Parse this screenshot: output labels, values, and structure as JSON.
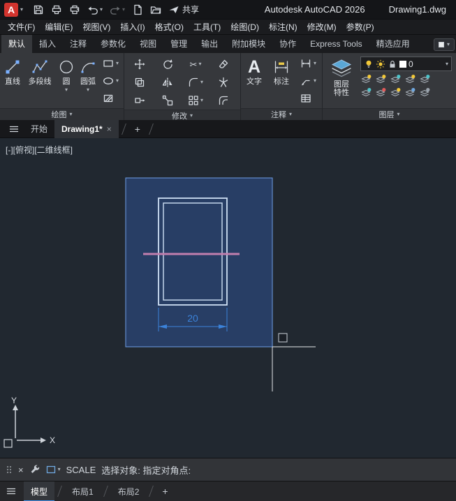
{
  "titlebar": {
    "logo_letter": "A",
    "app_title": "Autodesk AutoCAD 2026",
    "doc_title": "Drawing1.dwg",
    "share_label": "共享"
  },
  "menubar": {
    "items": [
      "文件(F)",
      "编辑(E)",
      "视图(V)",
      "插入(I)",
      "格式(O)",
      "工具(T)",
      "绘图(D)",
      "标注(N)",
      "修改(M)",
      "参数(P)"
    ]
  },
  "ribbon": {
    "tabs": [
      {
        "label": "默认",
        "active": true
      },
      {
        "label": "插入"
      },
      {
        "label": "注释"
      },
      {
        "label": "参数化"
      },
      {
        "label": "视图"
      },
      {
        "label": "管理"
      },
      {
        "label": "输出"
      },
      {
        "label": "附加模块"
      },
      {
        "label": "协作"
      },
      {
        "label": "Express Tools"
      },
      {
        "label": "精选应用"
      }
    ],
    "draw_panel": {
      "label": "绘图",
      "line_label": "直线",
      "polyline_label": "多段线",
      "circle_label": "圆",
      "arc_label": "圆弧"
    },
    "modify_panel": {
      "label": "修改"
    },
    "annotate_panel": {
      "label": "注释",
      "text_label": "文字",
      "dim_label": "标注"
    },
    "layer_panel": {
      "label": "图层",
      "properties_label": "图层特性",
      "current_layer": "0"
    }
  },
  "filetabs": {
    "start_label": "开始",
    "active_doc": "Drawing1*"
  },
  "viewport": {
    "controls_label": "[-][俯视][二维线框]",
    "dim_text": "20",
    "ucs_x_label": "X",
    "ucs_y_label": "Y"
  },
  "command_line": {
    "command": "SCALE",
    "prompt": "选择对象: 指定对角点:"
  },
  "statusbar": {
    "model_label": "模型",
    "layout1_label": "布局1",
    "layout2_label": "布局2"
  },
  "icons": {
    "chevron_down": "▾",
    "close": "×",
    "plus": "+",
    "scissors": "✂",
    "text_tool": "A"
  },
  "colors": {
    "accent_blue": "#3b82d9",
    "selection_fill": "rgba(56,110,210,0.33)",
    "selection_border": "#6f9fe8",
    "highlight_geometry": "#cfe0f5",
    "pink_line": "#c27fae",
    "bulb_yellow": "#f2c838",
    "logo_red": "#d2342e"
  }
}
